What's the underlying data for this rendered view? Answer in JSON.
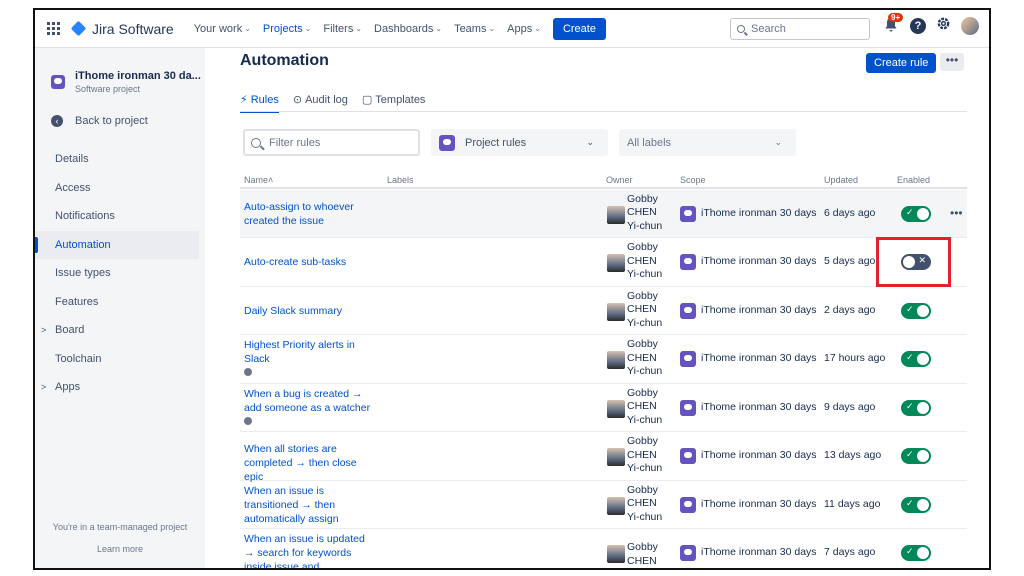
{
  "topnav": {
    "brand": "Jira Software",
    "items": [
      {
        "label": "Your work",
        "active": false
      },
      {
        "label": "Projects",
        "active": true
      },
      {
        "label": "Filters",
        "active": false
      },
      {
        "label": "Dashboards",
        "active": false
      },
      {
        "label": "Teams",
        "active": false
      },
      {
        "label": "Apps",
        "active": false
      }
    ],
    "create_label": "Create",
    "search_placeholder": "Search",
    "notification_badge": "9+",
    "help_label": "?"
  },
  "sidebar": {
    "project_name": "iThome ironman 30 da...",
    "project_type": "Software project",
    "back_label": "Back to project",
    "items": [
      {
        "label": "Details",
        "caret": ""
      },
      {
        "label": "Access",
        "caret": ""
      },
      {
        "label": "Notifications",
        "caret": ""
      },
      {
        "label": "Automation",
        "caret": "",
        "active": true
      },
      {
        "label": "Issue types",
        "caret": ""
      },
      {
        "label": "Features",
        "caret": ""
      },
      {
        "label": "Board",
        "caret": ">"
      },
      {
        "label": "Toolchain",
        "caret": ""
      },
      {
        "label": "Apps",
        "caret": ">"
      }
    ],
    "footer_text": "You're in a team-managed project",
    "learn_more": "Learn more"
  },
  "main": {
    "title": "Automation",
    "create_rule_label": "Create rule",
    "more_label": "•••",
    "tabs": [
      {
        "label": "Rules",
        "icon": "⚡",
        "active": true
      },
      {
        "label": "Audit log",
        "icon": "⊙",
        "active": false
      },
      {
        "label": "Templates",
        "icon": "▢",
        "active": false
      }
    ],
    "filter_placeholder": "Filter rules",
    "project_rules_label": "Project rules",
    "all_labels_label": "All labels"
  },
  "table": {
    "headers": {
      "name": "Name",
      "labels": "Labels",
      "owner": "Owner",
      "scope": "Scope",
      "updated": "Updated",
      "enabled": "Enabled"
    },
    "rows": [
      {
        "name": "Auto-assign to whoever created the issue",
        "owner": "Gobby CHEN Yi-chun",
        "scope": "iThome ironman 30 days",
        "updated": "6 days ago",
        "enabled": true,
        "info": false
      },
      {
        "name": "Auto-create sub-tasks",
        "owner": "Gobby CHEN Yi-chun",
        "scope": "iThome ironman 30 days",
        "updated": "5 days ago",
        "enabled": false,
        "info": false
      },
      {
        "name": "Daily Slack summary",
        "owner": "Gobby CHEN Yi-chun",
        "scope": "iThome ironman 30 days",
        "updated": "2 days ago",
        "enabled": true,
        "info": false
      },
      {
        "name": "Highest Priority alerts in Slack",
        "owner": "Gobby CHEN Yi-chun",
        "scope": "iThome ironman 30 days",
        "updated": "17 hours ago",
        "enabled": true,
        "info": true
      },
      {
        "name": "When a bug is created → add someone as a watcher",
        "owner": "Gobby CHEN Yi-chun",
        "scope": "iThome ironman 30 days",
        "updated": "9 days ago",
        "enabled": true,
        "info": true
      },
      {
        "name": "When all stories are completed → then close epic",
        "owner": "Gobby CHEN Yi-chun",
        "scope": "iThome ironman 30 days",
        "updated": "13 days ago",
        "enabled": true,
        "info": false
      },
      {
        "name": "When an issue is transitioned → then automatically assign",
        "owner": "Gobby CHEN Yi-chun",
        "scope": "iThome ironman 30 days",
        "updated": "11 days ago",
        "enabled": true,
        "info": false
      },
      {
        "name": "When an issue is updated → search for keywords inside issue and automatically",
        "owner": "Gobby CHEN",
        "scope": "iThome ironman 30 days",
        "updated": "7 days ago",
        "enabled": true,
        "info": false
      }
    ]
  },
  "colors": {
    "accent": "#0052cc",
    "toggle_on": "#00875a",
    "toggle_off": "#42526e",
    "highlight": "#e0232b"
  }
}
